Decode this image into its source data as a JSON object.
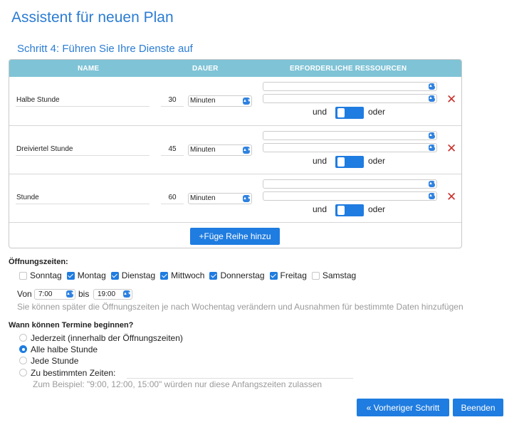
{
  "page": {
    "title": "Assistent für neuen Plan",
    "step_title": "Schritt 4: Führen Sie Ihre Dienste auf"
  },
  "table": {
    "headers": {
      "name": "NAME",
      "duration": "DAUER",
      "resources": "ERFORDERLICHE RESSOURCEN"
    },
    "rows": [
      {
        "name": "Halbe Stunde",
        "duration": "30",
        "unit": "Minuten",
        "resource_a": "",
        "resource_b": "",
        "and_label": "und",
        "or_label": "oder"
      },
      {
        "name": "Dreiviertel Stunde",
        "duration": "45",
        "unit": "Minuten",
        "resource_a": "",
        "resource_b": "",
        "and_label": "und",
        "or_label": "oder"
      },
      {
        "name": "Stunde",
        "duration": "60",
        "unit": "Minuten",
        "resource_a": "",
        "resource_b": "",
        "and_label": "und",
        "or_label": "oder"
      }
    ],
    "add_row_label": "+Füge Reihe hinzu"
  },
  "opening_hours": {
    "title": "Öffnungszeiten:",
    "days": [
      {
        "label": "Sonntag",
        "checked": false
      },
      {
        "label": "Montag",
        "checked": true
      },
      {
        "label": "Dienstag",
        "checked": true
      },
      {
        "label": "Mittwoch",
        "checked": true
      },
      {
        "label": "Donnerstag",
        "checked": true
      },
      {
        "label": "Freitag",
        "checked": true
      },
      {
        "label": "Samstag",
        "checked": false
      }
    ],
    "from_label": "Von",
    "from_value": "7:00",
    "to_label": "bis",
    "to_value": "19:00",
    "hint": "Sie können später die Öffnungszeiten je nach Wochentag verändern und Ausnahmen für bestimmte Daten hinzufügen"
  },
  "start_times": {
    "title": "Wann können Termine beginnen?",
    "options": [
      {
        "label": "Jederzeit (innerhalb der Öffnungszeiten)",
        "selected": false
      },
      {
        "label": "Alle halbe Stunde",
        "selected": true
      },
      {
        "label": "Jede Stunde",
        "selected": false
      },
      {
        "label": "Zu bestimmten Zeiten:",
        "selected": false
      }
    ],
    "specific_times_value": "",
    "hint": "Zum Beispiel: \"9:00, 12:00, 15:00\" würden nur diese Anfangszeiten zulassen"
  },
  "footer": {
    "prev_label": "« Vorheriger Schritt",
    "finish_label": "Beenden"
  },
  "colors": {
    "accent": "#1f7ce0",
    "title": "#2b7cd3",
    "table_header": "#7fc3d6",
    "delete": "#c9302c",
    "hint": "#9a9a9a"
  },
  "icons": {
    "delete": "close-icon",
    "select_arrow": "chevron-updown-icon"
  }
}
